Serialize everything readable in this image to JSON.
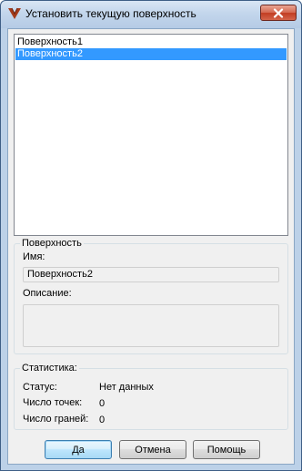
{
  "window": {
    "title": "Установить текущую поверхность"
  },
  "surfaces": [
    {
      "label": "Поверхность1",
      "selected": false
    },
    {
      "label": "Поверхность2",
      "selected": true
    }
  ],
  "surface_group": {
    "title": "Поверхность",
    "name_label": "Имя:",
    "name_value": "Поверхность2",
    "description_label": "Описание:",
    "description_value": ""
  },
  "stats_group": {
    "title": "Статистика:",
    "status_label": "Статус:",
    "status_value": "Нет данных",
    "points_label": "Число точек:",
    "points_value": "0",
    "faces_label": "Число граней:",
    "faces_value": "0"
  },
  "buttons": {
    "ok": "Да",
    "cancel": "Отмена",
    "help": "Помощь"
  },
  "colors": {
    "selection": "#3399ff",
    "close_button": "#c23d22"
  },
  "icons": {
    "app": "app-logo-icon",
    "close": "close-icon"
  }
}
